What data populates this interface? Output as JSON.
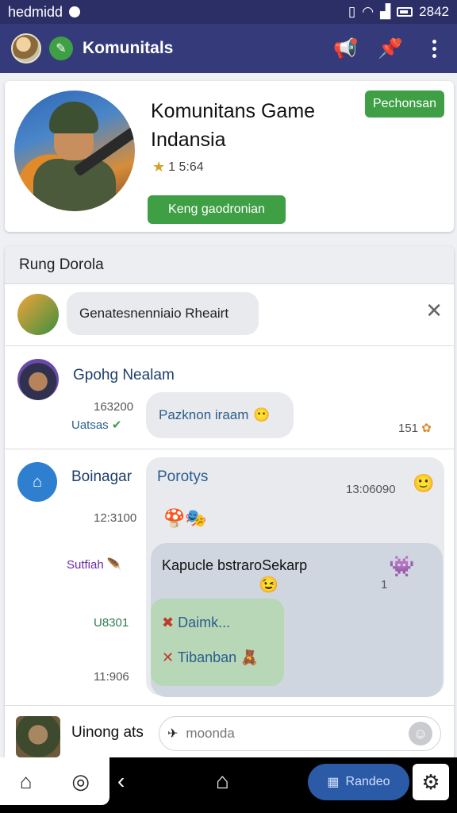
{
  "status_bar": {
    "carrier": "hedmidd",
    "time": "2842"
  },
  "app_bar": {
    "title": "Komunitals"
  },
  "community": {
    "name": "Komunitans Game Indansia",
    "rating": "1 5:64",
    "top_button": "Pechonsan",
    "join_button": "Keng gaodronian"
  },
  "section": {
    "title": "Rung Dorola"
  },
  "rows": [
    {
      "pill_text": "Genatesnenniaio Rheairt"
    },
    {
      "user": "Gpohg Nealam",
      "time": "163200",
      "status": "Uatsas",
      "message": "Pazknon iraam",
      "count": "151"
    },
    {
      "user": "Boinagar",
      "time": "12:3100",
      "reply_user": "Porotys",
      "reply_time": "13:06090",
      "sub1_label": "Sutfiah",
      "sub2_time": "U8301",
      "sub3_time": "11:906",
      "inner_title": "Kapucle bstraroSekarp",
      "inner_count": "1",
      "option1": "Daimk...",
      "option2": "Tibanban"
    }
  ],
  "composer": {
    "user": "Uinong ats",
    "placeholder": "moonda"
  },
  "nav": {
    "pill_label": "Randeo"
  },
  "colors": {
    "primary": "#343a7a",
    "status": "#2c2f66",
    "accent_green": "#3f9f45",
    "nav_blue": "#2b5aa6"
  },
  "icons": [
    "megaphone-icon",
    "pin-icon",
    "more-icon",
    "close-icon",
    "home-icon",
    "back-icon",
    "settings-icon"
  ]
}
